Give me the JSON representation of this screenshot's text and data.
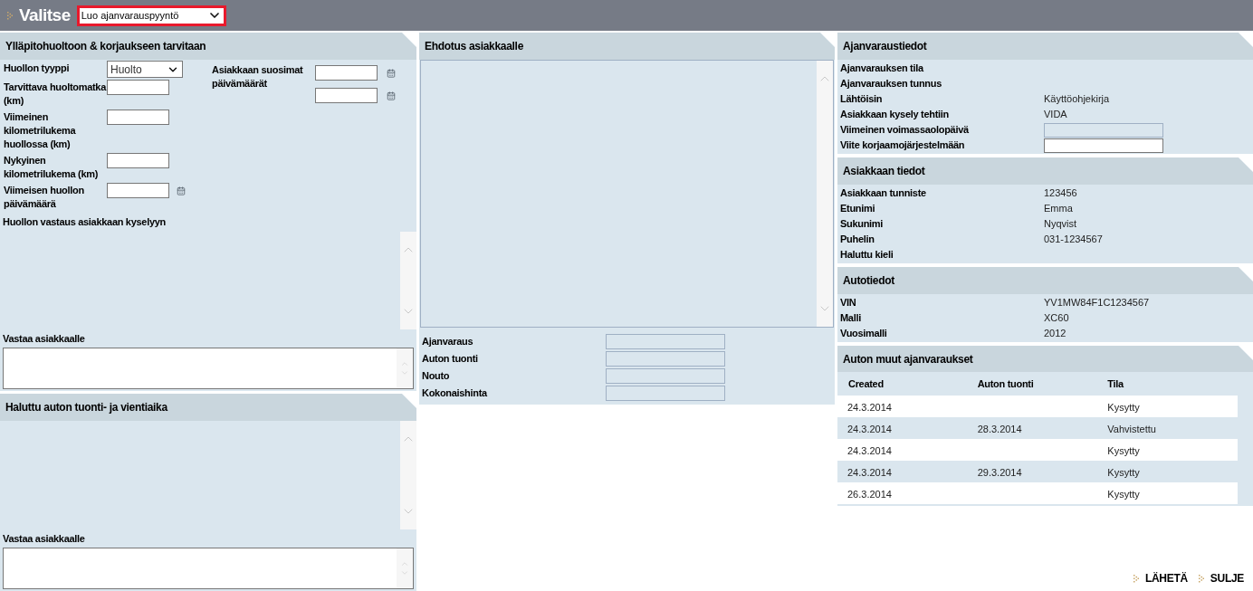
{
  "header": {
    "title": "Valitse",
    "action_select": "Luo ajanvarauspyyntö"
  },
  "maintenance": {
    "title": "Ylläpitohuoltoon & korjaukseen tarvitaan",
    "fields": [
      {
        "label": "Huollon tyyppi",
        "kind": "select",
        "value": "Huolto"
      },
      {
        "label": "Tarvittava huoltomatka (km)",
        "kind": "input"
      },
      {
        "label": "Viimeinen kilometrilukema huollossa (km)",
        "kind": "input"
      },
      {
        "label": "Nykyinen kilometrilukema (km)",
        "kind": "input"
      },
      {
        "label": "Viimeisen huollon päivämäärä",
        "kind": "date"
      }
    ],
    "preferred_dates": {
      "label": "Asiakkaan suosimat päivämäärät",
      "inputs": [
        {
          "kind": "date"
        },
        {
          "kind": "date"
        }
      ]
    },
    "response_label": "Huollon vastaus asiakkaan kyselyyn",
    "reply_label": "Vastaa asiakkaalle"
  },
  "delivery": {
    "title": "Haluttu auton tuonti- ja vientiaika",
    "reply_label": "Vastaa asiakkaalle"
  },
  "proposal": {
    "title": "Ehdotus asiakkaalle",
    "fields": [
      {
        "label": "Ajanvaraus",
        "disabled": true
      },
      {
        "label": "Auton tuonti",
        "disabled": true
      },
      {
        "label": "Nouto",
        "disabled": true
      },
      {
        "label": "Kokonaishinta",
        "disabled": true
      }
    ]
  },
  "booking_info": {
    "title": "Ajanvaraustiedot",
    "rows": [
      {
        "label": "Ajanvarauksen tila",
        "kind": "text"
      },
      {
        "label": "Ajanvarauksen tunnus",
        "kind": "text"
      },
      {
        "label": "Lähtöisin",
        "kind": "text",
        "value": "Käyttöohjekirja"
      },
      {
        "label": "Asiakkaan kysely tehtiin",
        "kind": "text",
        "value": "VIDA"
      },
      {
        "label": "Viimeinen voimassaolopäivä",
        "kind": "input",
        "disabled": true
      },
      {
        "label": "Viite korjaamojärjestelmään",
        "kind": "input",
        "disabled": false
      }
    ]
  },
  "customer": {
    "title": "Asiakkaan tiedot",
    "rows": [
      {
        "label": "Asiakkaan tunniste",
        "kind": "text",
        "value": "123456"
      },
      {
        "label": "Etunimi",
        "kind": "text",
        "value": "Emma"
      },
      {
        "label": "Sukunimi",
        "kind": "text",
        "value": "Nyqvist"
      },
      {
        "label": "Puhelin",
        "kind": "text",
        "value": "031-1234567"
      },
      {
        "label": "Haluttu kieli",
        "kind": "text"
      }
    ]
  },
  "car": {
    "title": "Autotiedot",
    "rows": [
      {
        "label": "VIN",
        "kind": "text",
        "value": "YV1MW84F1C1234567"
      },
      {
        "label": "Malli",
        "kind": "text",
        "value": "XC60"
      },
      {
        "label": "Vuosimalli",
        "kind": "text",
        "value": "2012"
      }
    ]
  },
  "other_bookings": {
    "title": "Auton muut ajanvaraukset",
    "columns": [
      "Created",
      "Auton tuonti",
      "Tila"
    ],
    "rows": [
      [
        "24.3.2014",
        "",
        "Kysytty"
      ],
      [
        "24.3.2014",
        "28.3.2014",
        "Vahvistettu"
      ],
      [
        "24.3.2014",
        "",
        "Kysytty"
      ],
      [
        "24.3.2014",
        "29.3.2014",
        "Kysytty"
      ],
      [
        "26.3.2014",
        "",
        "Kysytty"
      ]
    ]
  },
  "actions": [
    "LÄHETÄ",
    "SULJE"
  ]
}
